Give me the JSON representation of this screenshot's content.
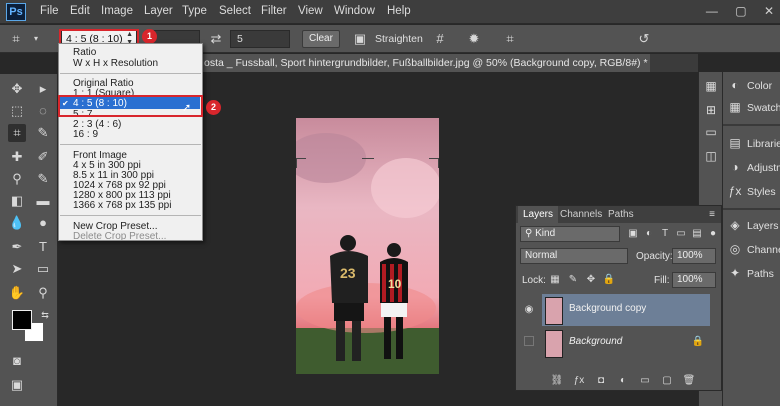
{
  "app": {
    "logo": "Ps"
  },
  "menu": [
    "File",
    "Edit",
    "Image",
    "Layer",
    "Type",
    "Select",
    "Filter",
    "View",
    "Window",
    "Help"
  ],
  "window_controls": {
    "minimize": "—",
    "restore": "▢",
    "close": "✕"
  },
  "options_bar": {
    "ratio_value": "4 : 5 (8 : 10)",
    "ratio_field_value": "5",
    "clear_label": "Clear",
    "straighten_label": "Straighten"
  },
  "badges": {
    "step1": "1",
    "step2": "2"
  },
  "document_tab": {
    "title": "osta _ Fussball, Sport hintergrundbilder, Fußballbilder.jpg @ 50% (Background copy, RGB/8#) *"
  },
  "crop_menu": {
    "group1": [
      "Ratio",
      "W x H x Resolution"
    ],
    "group2": [
      "Original Ratio",
      "1 : 1 (Square)",
      "4 : 5 (8 : 10)",
      "5 : 7",
      "2 : 3 (4 : 6)",
      "16 : 9"
    ],
    "selected_index": 2,
    "group3": [
      "Front Image",
      "4 x 5 in 300 ppi",
      "8.5 x 11 in 300 ppi",
      "1024 x 768 px 92 ppi",
      "1280 x 800 px 113 ppi",
      "1366 x 768 px 135 ppi"
    ],
    "group4": [
      "New Crop Preset...",
      "Delete Crop Preset..."
    ]
  },
  "right_dock": [
    "Color",
    "Swatches",
    "Libraries",
    "Adjustments",
    "Styles",
    "Layers",
    "Channels",
    "Paths"
  ],
  "layers_panel": {
    "tabs": [
      "Layers",
      "Channels",
      "Paths"
    ],
    "filter_kind": "Kind",
    "blend_mode": "Normal",
    "opacity_label": "Opacity:",
    "opacity_value": "100%",
    "lock_label": "Lock:",
    "fill_label": "Fill:",
    "fill_value": "100%",
    "layers": [
      {
        "name": "Background copy",
        "selected": true,
        "visible": true
      },
      {
        "name": "Background",
        "selected": false,
        "visible": false,
        "locked": true
      }
    ]
  },
  "photo": {
    "jersey_left": "23",
    "jersey_right": "10"
  }
}
